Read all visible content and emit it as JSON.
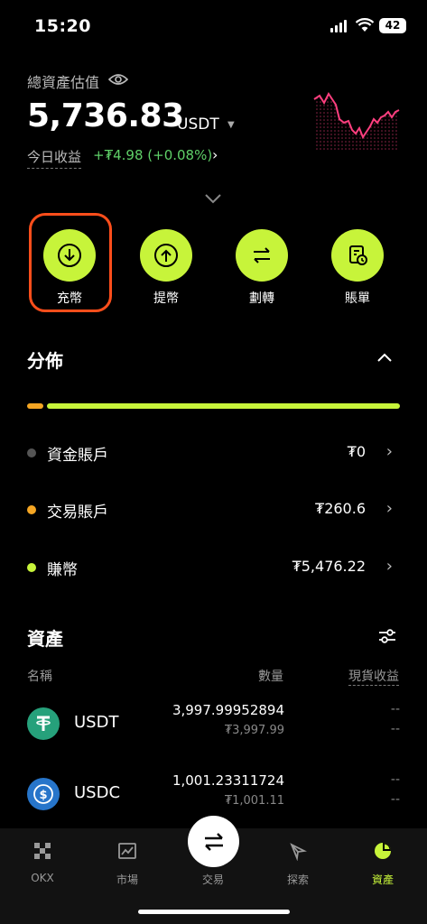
{
  "status": {
    "time": "15:20",
    "battery": "42"
  },
  "header": {
    "valuation_label": "總資產估值",
    "balance": "5,736.83",
    "unit": "USDT",
    "pnl_label": "今日收益",
    "pnl_value": "+₮4.98 (+0.08%)"
  },
  "actions": [
    {
      "label": "充幣",
      "icon": "deposit-icon"
    },
    {
      "label": "提幣",
      "icon": "withdraw-icon"
    },
    {
      "label": "劃轉",
      "icon": "transfer-icon"
    },
    {
      "label": "賬單",
      "icon": "bill-icon"
    }
  ],
  "distribution": {
    "title": "分佈",
    "accounts": [
      {
        "name": "資金賬戶",
        "value": "₮0",
        "color": "#555555"
      },
      {
        "name": "交易賬戶",
        "value": "₮260.6",
        "color": "#f5a623"
      },
      {
        "name": "賺幣",
        "value": "₮5,476.22",
        "color": "#c7f43a"
      }
    ]
  },
  "assets": {
    "title": "資產",
    "columns": {
      "name": "名稱",
      "quantity": "數量",
      "spot_pnl": "現貨收益"
    },
    "rows": [
      {
        "symbol": "USDT",
        "amount": "3,997.99952894",
        "fiat": "₮3,997.99",
        "pnl1": "--",
        "pnl2": "--",
        "coin_color": "#26a17b"
      },
      {
        "symbol": "USDC",
        "amount": "1,001.23311724",
        "fiat": "₮1,001.11",
        "pnl1": "--",
        "pnl2": "--",
        "coin_color": "#2775ca"
      }
    ]
  },
  "nav": {
    "items": [
      {
        "label": "OKX",
        "icon": "okx-logo-icon"
      },
      {
        "label": "市場",
        "icon": "market-chart-icon"
      },
      {
        "label": "交易",
        "icon": "trade-swap-icon"
      },
      {
        "label": "探索",
        "icon": "explore-compass-icon"
      },
      {
        "label": "資產",
        "icon": "assets-pie-icon"
      }
    ],
    "active": "資產",
    "active_color": "#c7f43a"
  },
  "colors": {
    "accent": "#c7f43a",
    "positive": "#5fd068",
    "highlight": "#ff4e1b",
    "sparkline": "#ff3f7f"
  }
}
